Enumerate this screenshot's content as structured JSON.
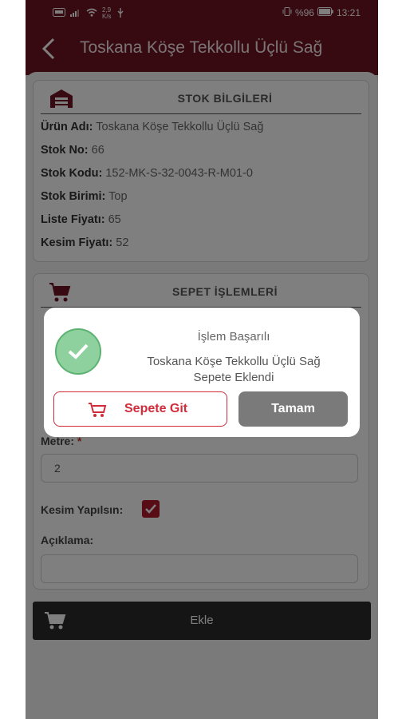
{
  "status_bar": {
    "speed_value": "2,9",
    "speed_unit": "K/s",
    "battery": "%96",
    "time": "13:21"
  },
  "app_bar": {
    "title": "Toskana Köşe Tekkollu Üçlü Sağ"
  },
  "stock_card": {
    "title": "STOK BİLGİLERİ",
    "rows": [
      {
        "label": "Ürün Adı:",
        "value": "Toskana Köşe Tekkollu Üçlü Sağ"
      },
      {
        "label": "Stok No:",
        "value": "66"
      },
      {
        "label": "Stok Kodu:",
        "value": "152-MK-S-32-0043-R-M01-0"
      },
      {
        "label": "Stok Birimi:",
        "value": "Top"
      },
      {
        "label": "Liste Fiyatı:",
        "value": "65"
      },
      {
        "label": "Kesim Fiyatı:",
        "value": "52"
      }
    ]
  },
  "basket_card": {
    "title": "SEPET İŞLEMLERİ",
    "metre_label": "Metre:",
    "metre_required": "*",
    "metre_value": "2",
    "cut_label": "Kesim Yapılsın:",
    "cut_checked": true,
    "description_label": "Açıklama:",
    "description_value": ""
  },
  "add_button": {
    "label": "Ekle"
  },
  "dialog": {
    "title": "İşlem Başarılı",
    "message_line1": "Toskana Köşe Tekkollu Üçlü Sağ",
    "message_line2": "Sepete Eklendi",
    "go_to_cart_label": "Sepete Git",
    "ok_label": "Tamam"
  },
  "colors": {
    "brand": "#6e1321",
    "accent_red": "#d22c3a",
    "success_green": "#8fd19e",
    "dark_button": "#2a2a2a",
    "gray_button": "#7a7a7a"
  }
}
